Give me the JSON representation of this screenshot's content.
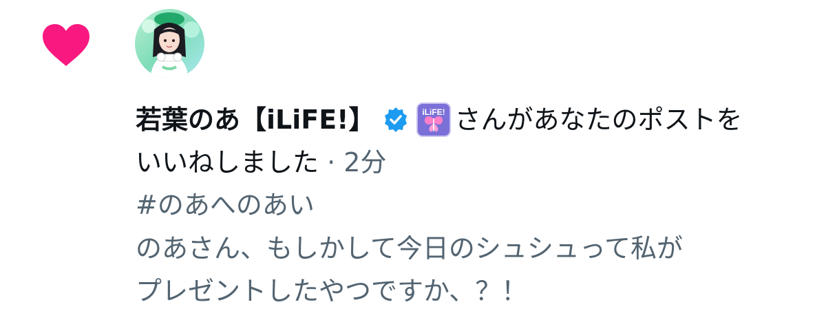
{
  "notification": {
    "type_icon": "heart-icon",
    "type_icon_color": "#f91880",
    "user": {
      "name": "若葉のあ【iLiFE!】",
      "verified_icon": "verified-badge-icon",
      "verified_color": "#1d9bf0",
      "affiliate_badge_icon": "ilife-badge-icon",
      "affiliate_badge_text": "iLiFE!"
    },
    "action_line1": "さんがあなたのポストを",
    "action_line2": "いいねしました",
    "separator": " · ",
    "time_ago": "2分",
    "post": {
      "hashtag": "#のあへのあい",
      "line1": "のあさん、もしかして今日のシュシュって私が",
      "line2": "プレゼントしたやつですか、？！"
    }
  }
}
